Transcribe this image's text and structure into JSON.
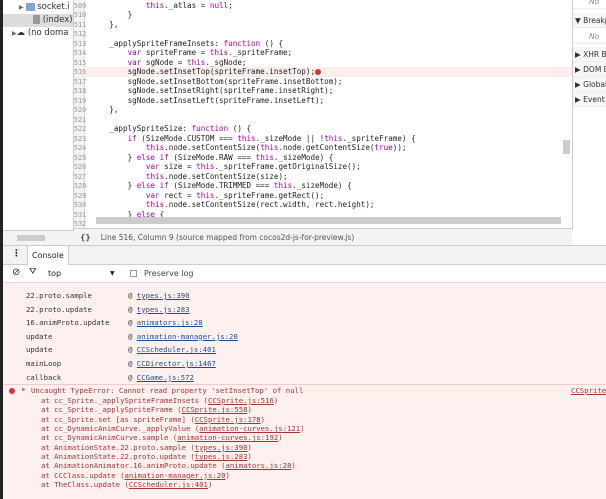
{
  "navigator": {
    "items": [
      {
        "label": "socket.i",
        "icon": "folder-icon"
      },
      {
        "label": "(index)",
        "icon": "file-icon",
        "selected": true
      },
      {
        "label": "(no doma",
        "icon": "cloud-icon"
      }
    ]
  },
  "editor": {
    "lines": [
      {
        "n": "509",
        "t": "            this._atlas = null;"
      },
      {
        "n": "510",
        "t": "        }"
      },
      {
        "n": "511",
        "t": "    },"
      },
      {
        "n": "512",
        "t": ""
      },
      {
        "n": "513",
        "t": "    _applySpriteFrameInsets: function () {"
      },
      {
        "n": "514",
        "t": "        var spriteFrame = this._spriteFrame;"
      },
      {
        "n": "515",
        "t": "        var sgNode = this._sgNode;"
      },
      {
        "n": "516",
        "t": "        sgNode.setInsetTop(spriteFrame.insetTop);",
        "error": true
      },
      {
        "n": "517",
        "t": "        sgNode.setInsetBottom(spriteFrame.insetBottom);"
      },
      {
        "n": "518",
        "t": "        sgNode.setInsetRight(spriteFrame.insetRight);"
      },
      {
        "n": "519",
        "t": "        sgNode.setInsetLeft(spriteFrame.insetLeft);"
      },
      {
        "n": "520",
        "t": "    },"
      },
      {
        "n": "521",
        "t": ""
      },
      {
        "n": "522",
        "t": "    _applySpriteSize: function () {"
      },
      {
        "n": "523",
        "t": "        if (SizeMode.CUSTOM === this._sizeMode || !this._spriteFrame) {"
      },
      {
        "n": "524",
        "t": "            this.node.setContentSize(this.node.getContentSize(true));"
      },
      {
        "n": "525",
        "t": "        } else if (SizeMode.RAW === this._sizeMode) {"
      },
      {
        "n": "526",
        "t": "            var size = this._spriteFrame.getOriginalSize();"
      },
      {
        "n": "527",
        "t": "            this.node.setContentSize(size);"
      },
      {
        "n": "528",
        "t": "        } else if (SizeMode.TRIMMED === this._sizeMode) {"
      },
      {
        "n": "529",
        "t": "            var rect = this._spriteFrame.getRect();"
      },
      {
        "n": "530",
        "t": "            this.node.setContentSize(rect.width, rect.height);"
      },
      {
        "n": "531",
        "t": "        } else {"
      },
      {
        "n": "532",
        "t": ""
      }
    ]
  },
  "right_panel": {
    "items": [
      {
        "label": "No",
        "note": true
      },
      {
        "label": "▼ Breakpoints"
      },
      {
        "label": "No",
        "note": true
      },
      {
        "label": "▶ XHR Breakpoints"
      },
      {
        "label": "▶ DOM Breakpoints"
      },
      {
        "label": "▶ Global Listeners"
      },
      {
        "label": "▶ Event Listener Breakpoints"
      }
    ]
  },
  "status": {
    "format_icon": "{}",
    "text": "Line 516, Column 9  (source mapped from cocos2d-js-for-preview.js)"
  },
  "drawer": {
    "menu_icon": "⋮",
    "tab": "Console"
  },
  "filter": {
    "context": "top",
    "preserve_log": "Preserve log",
    "preserve_checked": false
  },
  "frames": [
    {
      "fn": "22.proto.sample",
      "loc": "types.js:390"
    },
    {
      "fn": "22.proto.update",
      "loc": "types.js:283"
    },
    {
      "fn": "16.animProto.update",
      "loc": "animators.js:28"
    },
    {
      "fn": "update",
      "loc": "animation-manager.js:20"
    },
    {
      "fn": "update",
      "loc": "CCScheduler.js:401"
    },
    {
      "fn": "mainLoop",
      "loc": "CCDirector.js:1467"
    },
    {
      "fn": "callback",
      "loc": "CCGame.js:572"
    }
  ],
  "error": {
    "message": "Uncaught TypeError: Cannot read property 'setInsetTop' of null",
    "source": "CCSprite",
    "stack": [
      {
        "pre": "at cc_Sprite._applySpriteFrameInsets (",
        "loc": "CCSprite.js:516"
      },
      {
        "pre": "at cc_Sprite._applySpriteFrame (",
        "loc": "CCSprite.js:558"
      },
      {
        "pre": "at cc_Sprite.set [as spriteFrame] (",
        "loc": "CCSprite.js:178"
      },
      {
        "pre": "at cc_DynamicAnimCurve._applyValue (",
        "loc": "animation-curves.js:121"
      },
      {
        "pre": "at cc_DynamicAnimCurve.sample (",
        "loc": "animation-curves.js:192"
      },
      {
        "pre": "at AnimationState.22.proto.sample (",
        "loc": "types.js:390"
      },
      {
        "pre": "at AnimationState.22.proto.update (",
        "loc": "types.js:283"
      },
      {
        "pre": "at AnimationAnimator.16.animProto.update (",
        "loc": "animators.js:28"
      },
      {
        "pre": "at CCClass.update (",
        "loc": "animation-manager.js:20"
      },
      {
        "pre": "at TheClass.update (",
        "loc": "CCScheduler.js:401"
      }
    ]
  }
}
